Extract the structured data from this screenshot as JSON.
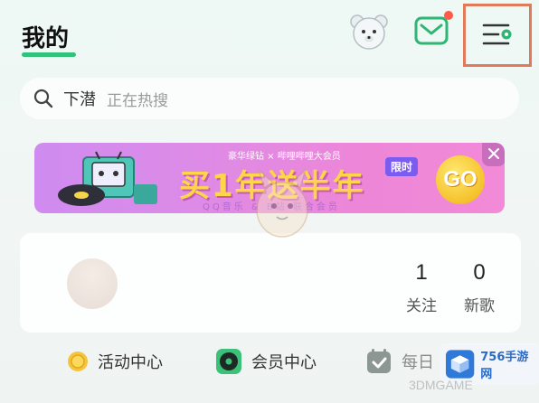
{
  "header": {
    "title": "我的",
    "icons": [
      "bear-avatar-icon",
      "mail-icon",
      "menu-settings-icon"
    ],
    "accent_color": "#31c27c",
    "highlight_color": "#e07a5a"
  },
  "search": {
    "keyword": "下潜",
    "hint": "正在热搜"
  },
  "banner": {
    "brands": "豪华绿钻 × 哔哩哔哩大会员",
    "headline": "买1年送半年",
    "tag": "限时",
    "subtitle": "QQ音乐 & B站 联合会员",
    "cta": "GO",
    "colors": {
      "start": "#cf8bf0",
      "end": "#f28ad8",
      "headline": "#ffd64a"
    }
  },
  "profile": {
    "stats": [
      {
        "value": "1",
        "label": "关注"
      },
      {
        "value": "0",
        "label": "新歌"
      }
    ]
  },
  "quick_entries": [
    {
      "label": "活动中心",
      "icon": "coin-icon"
    },
    {
      "label": "会员中心",
      "icon": "vinyl-icon"
    },
    {
      "label": "每日",
      "icon": "calendar-check-icon"
    }
  ],
  "watermarks": {
    "badge_text": "756手游网",
    "corner_text": "3DMGAME"
  }
}
